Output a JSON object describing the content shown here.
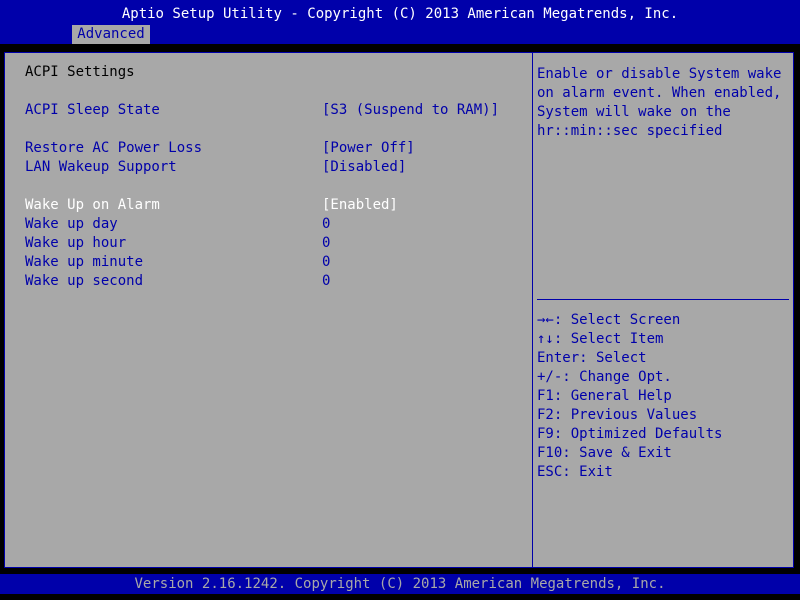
{
  "header": {
    "title": "Aptio Setup Utility - Copyright (C) 2013 American Megatrends, Inc.",
    "tab": "Advanced"
  },
  "main": {
    "section_title": "ACPI Settings",
    "settings": [
      {
        "label": "ACPI Sleep State",
        "value": "[S3 (Suspend to RAM)]"
      },
      {
        "label": "Restore AC Power Loss",
        "value": "[Power Off]"
      },
      {
        "label": "LAN Wakeup Support",
        "value": "[Disabled]"
      },
      {
        "label": "Wake Up on Alarm",
        "value": "[Enabled]"
      },
      {
        "label": "Wake up day",
        "value": "0"
      },
      {
        "label": "Wake up hour",
        "value": "0"
      },
      {
        "label": "Wake up minute",
        "value": "0"
      },
      {
        "label": "Wake up second",
        "value": "0"
      }
    ]
  },
  "help": {
    "lines": [
      "Enable or disable System wake",
      "on alarm event. When enabled,",
      "System will wake on the",
      "hr::min::sec specified"
    ]
  },
  "keys": [
    "→←: Select Screen",
    "↑↓: Select Item",
    "Enter: Select",
    "+/-: Change Opt.",
    "F1: General Help",
    "F2: Previous Values",
    "F9: Optimized Defaults",
    "F10: Save & Exit",
    "ESC: Exit"
  ],
  "footer": {
    "text": "Version 2.16.1242. Copyright (C) 2013 American Megatrends, Inc."
  },
  "colors": {
    "background": "#A8A8A8",
    "accent": "#0000AA",
    "selected_text": "#FFFFFF"
  }
}
